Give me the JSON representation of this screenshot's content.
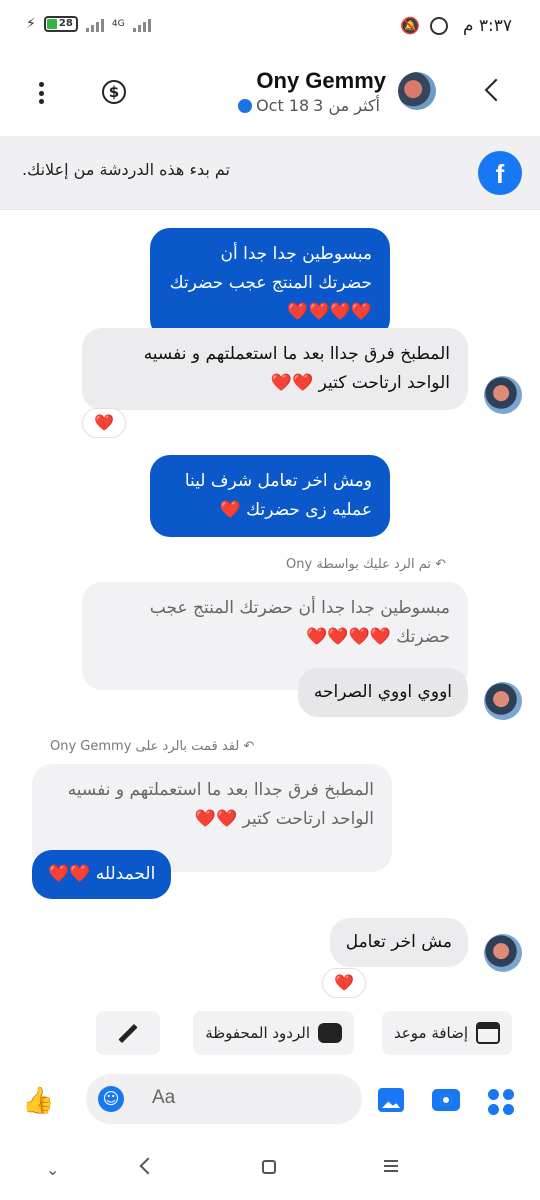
{
  "status_bar": {
    "time": "٣:٣٧ م",
    "battery": "28",
    "network": "4G"
  },
  "header": {
    "name": "Ony Gemmy",
    "last_active": "أكثر من 3",
    "date": "Oct 18"
  },
  "ad_banner": {
    "text": ".تم بدء هذه الدردشة من إعلانك"
  },
  "messages": [
    {
      "type": "sent",
      "text": "مبسوطين جدا جدا أن حضرتك المنتج عجب حضرتك",
      "hearts": "❤️❤️❤️❤️"
    },
    {
      "type": "received",
      "text": "المطبخ فرق جداا بعد ما استعملتهم و نفسيه الواحد ارتاحت كتير",
      "hearts": "❤️❤️",
      "reaction": "❤️"
    },
    {
      "type": "sent",
      "text": "ومش اخر تعامل شرف لينا عمليه زى حضرتك",
      "hearts": "❤️"
    },
    {
      "type": "received",
      "reply_note": "تم الرد عليك بواسطة Ony",
      "quote_text": "مبسوطين جدا جدا أن حضرتك المنتج عجب حضرتك",
      "quote_hearts": "❤️❤️❤️❤️",
      "text": "اووي اووي الصراحه"
    },
    {
      "type": "sent",
      "reply_note": "لقد قمت بالرد على Ony Gemmy",
      "quote_text": "المطبخ فرق جداا بعد ما استعملتهم و نفسيه الواحد ارتاحت كتير",
      "quote_hearts": "❤️❤️",
      "text": "الحمدلله",
      "hearts": "❤️❤️"
    },
    {
      "type": "received",
      "text": "مش اخر تعامل",
      "reaction": "❤️"
    }
  ],
  "quick_replies": {
    "add_appointment": "إضافة موعد",
    "saved_replies": "الردود المحفوظة"
  },
  "composer": {
    "placeholder": "Aa"
  },
  "icons": {
    "brand_color": "#1877f2",
    "sent_bubble_color": "#0a58ca",
    "received_bubble_color": "#ececee"
  }
}
